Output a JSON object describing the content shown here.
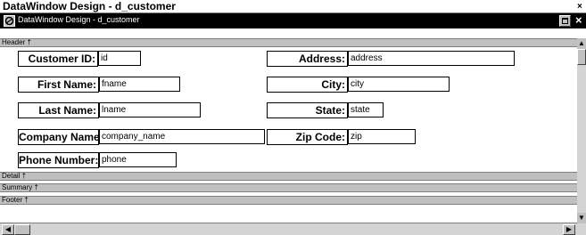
{
  "window": {
    "outer_title": "DataWindow Design - d_customer",
    "inner_title": "DataWindow Design - d_customer",
    "close_glyph": "×",
    "icons": [
      "datawindow-icon",
      "restore-icon",
      "close-icon"
    ]
  },
  "bands": {
    "header": "Header †",
    "detail": "Detail †",
    "summary": "Summary †",
    "footer": "Footer †"
  },
  "fields": {
    "customer_id": {
      "label": "Customer ID:",
      "value": "id"
    },
    "address": {
      "label": "Address:",
      "value": "address"
    },
    "first_name": {
      "label": "First Name:",
      "value": "fname"
    },
    "city": {
      "label": "City:",
      "value": "city"
    },
    "last_name": {
      "label": "Last Name:",
      "value": "lname"
    },
    "state": {
      "label": "State:",
      "value": "state"
    },
    "company_name": {
      "label": "Company Name:",
      "value": "company_name"
    },
    "zip_code": {
      "label": "Zip Code:",
      "value": "zip"
    },
    "phone_number": {
      "label": "Phone Number:",
      "value": "phone"
    }
  },
  "colors": {
    "titlebar_active": "#000000",
    "band": "#c0c0c0",
    "background": "#ffffff"
  }
}
